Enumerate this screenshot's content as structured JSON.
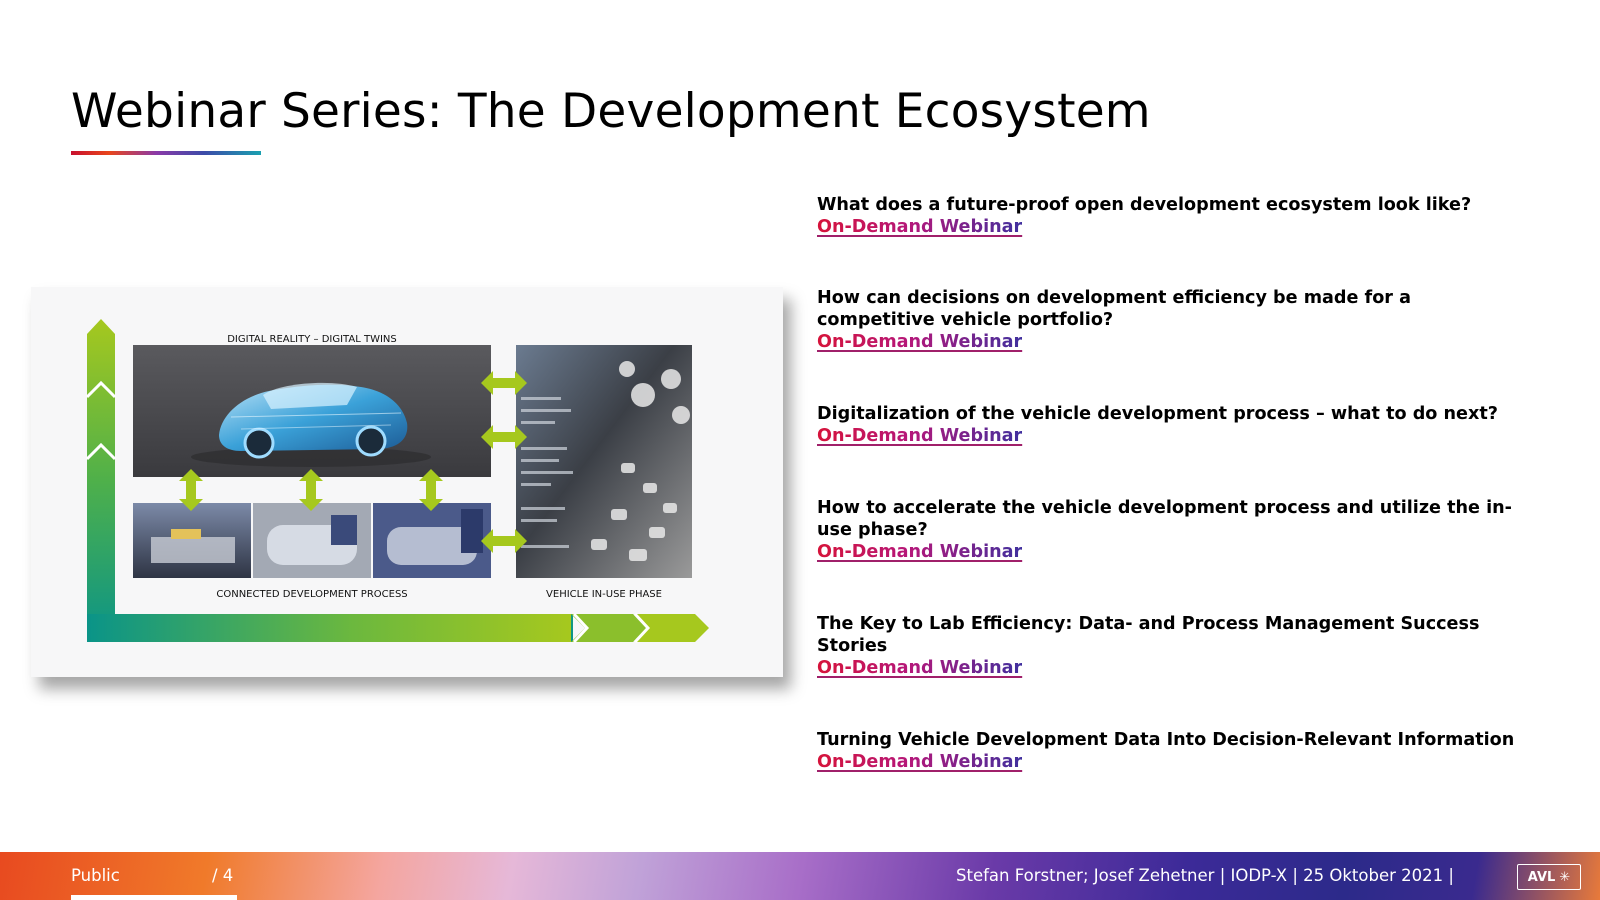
{
  "slide": {
    "title": "Webinar Series: The Development Ecosystem"
  },
  "diagram": {
    "label_top": "DIGITAL REALITY – DIGITAL TWINS",
    "label_bottom_left": "CONNECTED DEVELOPMENT PROCESS",
    "label_bottom_right": "VEHICLE IN-USE PHASE",
    "accent_green": "#a6c81e",
    "accent_teal": "#0a9488"
  },
  "webinars": [
    {
      "question": "What does a future-proof open development ecosystem look  like?",
      "link": "On-Demand Webinar"
    },
    {
      "question": "How can decisions on development efficiency be made for a competitive vehicle portfolio?",
      "link": "On-Demand Webinar"
    },
    {
      "question": "Digitalization of the vehicle development process – what to do  next?",
      "link": "On-Demand Webinar"
    },
    {
      "question": "How to accelerate the vehicle development process and utilize the in-use phase?",
      "link": "On-Demand Webinar"
    },
    {
      "question": "The Key to Lab Efficiency: Data- and Process Management Success Stories",
      "link": "On-Demand Webinar"
    },
    {
      "question": "Turning Vehicle Development Data Into Decision-Relevant  Information",
      "link": "On-Demand Webinar"
    }
  ],
  "footer": {
    "classification": "Public",
    "page": "/ 4",
    "credits": "Stefan Forstner; Josef Zehetner | IODP-X | 25 Oktober 2021  |",
    "logo_text": "AVL"
  }
}
